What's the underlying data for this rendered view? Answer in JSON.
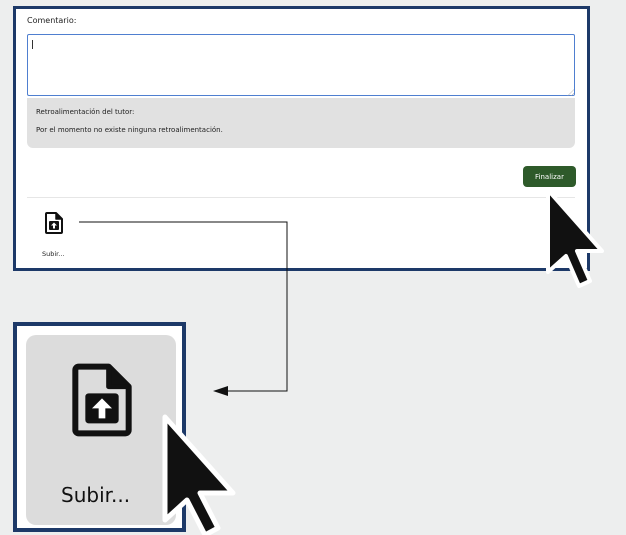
{
  "form": {
    "comment_label": "Comentario:",
    "comment_value": "",
    "feedback_title": "Retroalimentación del tutor:",
    "feedback_text": "Por el momento no existe ninguna retroalimentación.",
    "finalize_label": "Finalizar"
  },
  "upload": {
    "label": "Subir...",
    "icon": "file-upload-icon"
  },
  "zoom": {
    "label": "Subir...",
    "icon": "file-upload-icon"
  },
  "colors": {
    "frame": "#1d3968",
    "finalize_button": "#2e5a2a",
    "feedback_bg": "#e1e1e1",
    "background": "#edeeee"
  }
}
